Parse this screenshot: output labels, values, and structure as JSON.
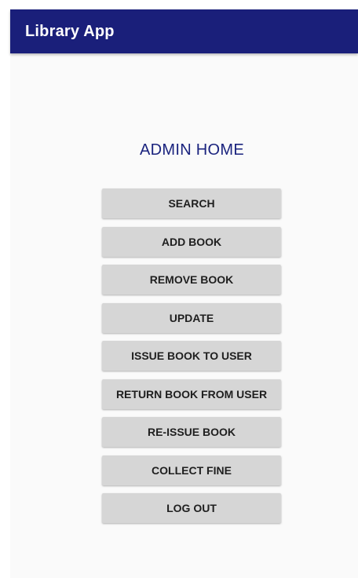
{
  "app_bar": {
    "title": "Library App"
  },
  "main": {
    "heading": "ADMIN HOME",
    "buttons": [
      {
        "id": "search",
        "label": "SEARCH"
      },
      {
        "id": "add-book",
        "label": "ADD BOOK"
      },
      {
        "id": "remove-book",
        "label": "REMOVE BOOK"
      },
      {
        "id": "update",
        "label": "UPDATE"
      },
      {
        "id": "issue-book",
        "label": "ISSUE BOOK TO USER"
      },
      {
        "id": "return-book",
        "label": "RETURN BOOK FROM USER"
      },
      {
        "id": "reissue-book",
        "label": "RE-ISSUE BOOK"
      },
      {
        "id": "collect-fine",
        "label": "COLLECT FINE"
      },
      {
        "id": "log-out",
        "label": "LOG OUT"
      }
    ]
  },
  "colors": {
    "app_bar": "#1a1f7a",
    "heading": "#1a237e",
    "button_bg": "#d6d6d6",
    "background": "#fafafa"
  }
}
